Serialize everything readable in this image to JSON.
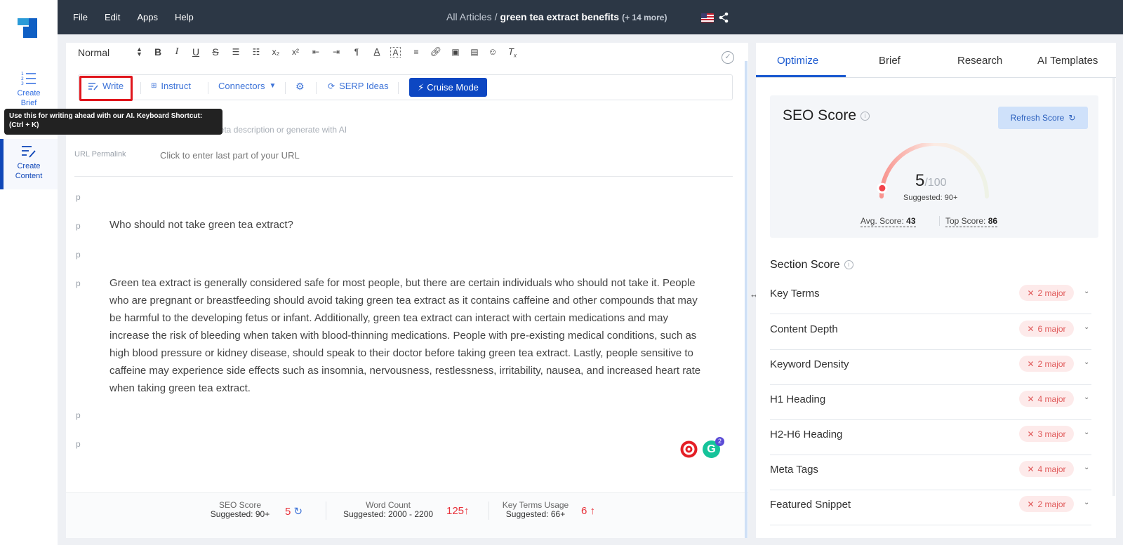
{
  "app": {
    "menu": [
      "File",
      "Edit",
      "Apps",
      "Help"
    ],
    "breadcrumb": {
      "root": "All Articles",
      "separator": "/",
      "current": "green tea extract benefits",
      "more": "(+ 14 more)"
    }
  },
  "sidebar": {
    "items": [
      {
        "label": "Create Brief",
        "icon": "list-numbered-icon"
      },
      {
        "label": "Create Content",
        "icon": "edit-lines-icon"
      }
    ]
  },
  "toolbar": {
    "format": "Normal",
    "ai_buttons": {
      "write": "Write",
      "instruct": "Instruct",
      "connectors": "Connectors",
      "serp": "SERP Ideas",
      "cruise": "Cruise Mode"
    },
    "tooltip": "Use this for writing ahead with our AI. Keyboard Shortcut: (Ctrl + K)"
  },
  "editor": {
    "meta_placeholder": "Type your meta description or generate with AI",
    "meta_visible": "neta description or generate with AI",
    "permalink_label": "URL Permalink",
    "permalink_placeholder": "Click to enter last part of your URL",
    "ptag": "p",
    "question": "Who should not take green tea extract?",
    "paragraph_lines": [
      "Green tea extract is generally considered safe for most people, but there are certain individuals who should not take it. People",
      "who are pregnant or breastfeeding should avoid taking green tea extract as it contains caffeine and other compounds that may",
      "be harmful to the developing fetus or infant. Additionally, green tea extract can interact with certain medications and may",
      "increase the risk of bleeding when taken with blood-thinning medications. People with pre-existing medical conditions, such as",
      "high blood pressure or kidney disease, should speak to their doctor before taking green tea extract. Lastly, people sensitive to",
      "caffeine may experience side effects such as insomnia, nervousness, restlessness, irritability, nausea, and increased heart rate",
      "when taking green tea extract."
    ],
    "grammarly_count": "2"
  },
  "footer": {
    "seo": {
      "label": "SEO Score",
      "suggested": "Suggested: 90+",
      "value": "5"
    },
    "words": {
      "label": "Word Count",
      "suggested": "Suggested: 2000 - 2200",
      "value": "125"
    },
    "terms": {
      "label": "Key Terms Usage",
      "suggested": "Suggested: 66+",
      "value": "6"
    }
  },
  "rightpanel": {
    "tabs": [
      "Optimize",
      "Brief",
      "Research",
      "AI Templates"
    ],
    "seo": {
      "title": "SEO Score",
      "refresh": "Refresh Score",
      "score": "5",
      "max": "/100",
      "score_fraction": 0.05,
      "suggested": "Suggested: 90+",
      "avg_label": "Avg. Score:",
      "avg": "43",
      "top_label": "Top Score:",
      "top": "86"
    },
    "section_title": "Section Score",
    "sections": [
      {
        "name": "Key Terms",
        "badge": "2 major"
      },
      {
        "name": "Content Depth",
        "badge": "6 major"
      },
      {
        "name": "Keyword Density",
        "badge": "2 major"
      },
      {
        "name": "H1 Heading",
        "badge": "4 major"
      },
      {
        "name": "H2-H6 Heading",
        "badge": "3 major"
      },
      {
        "name": "Meta Tags",
        "badge": "4 major"
      },
      {
        "name": "Featured Snippet",
        "badge": "2 major"
      }
    ]
  },
  "colors": {
    "accent": "#1b5ad0",
    "header": "#2c3745",
    "danger": "#e8313a",
    "cruise": "#0d47c2"
  }
}
